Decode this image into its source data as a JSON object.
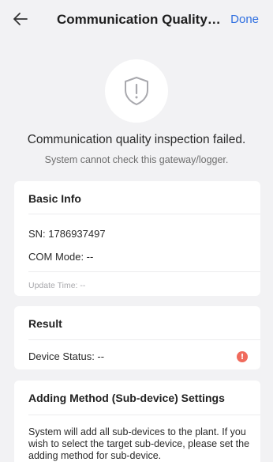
{
  "header": {
    "back_icon": "back-arrow-icon",
    "title": "Communication Quality In...",
    "done_label": "Done"
  },
  "status": {
    "icon": "shield-alert-icon",
    "title": "Communication quality inspection failed.",
    "subtitle": "System cannot check this gateway/logger."
  },
  "basic_info": {
    "title": "Basic Info",
    "sn": "SN: 1786937497",
    "com_mode": "COM Mode: --",
    "update_time": "Update Time: --"
  },
  "result": {
    "title": "Result",
    "device_status": "Device Status: --",
    "status_icon": "error-icon",
    "status_icon_glyph": "!",
    "status_color": "#f06a5c"
  },
  "adding_method": {
    "title": "Adding Method (Sub-device) Settings",
    "description": "System will add all sub-devices to the plant. If you wish to select the target sub-device, please set the adding method for sub-device."
  },
  "colors": {
    "accent": "#2f6fe0",
    "background": "#f2f2f4",
    "card": "#ffffff",
    "error": "#f06a5c"
  }
}
